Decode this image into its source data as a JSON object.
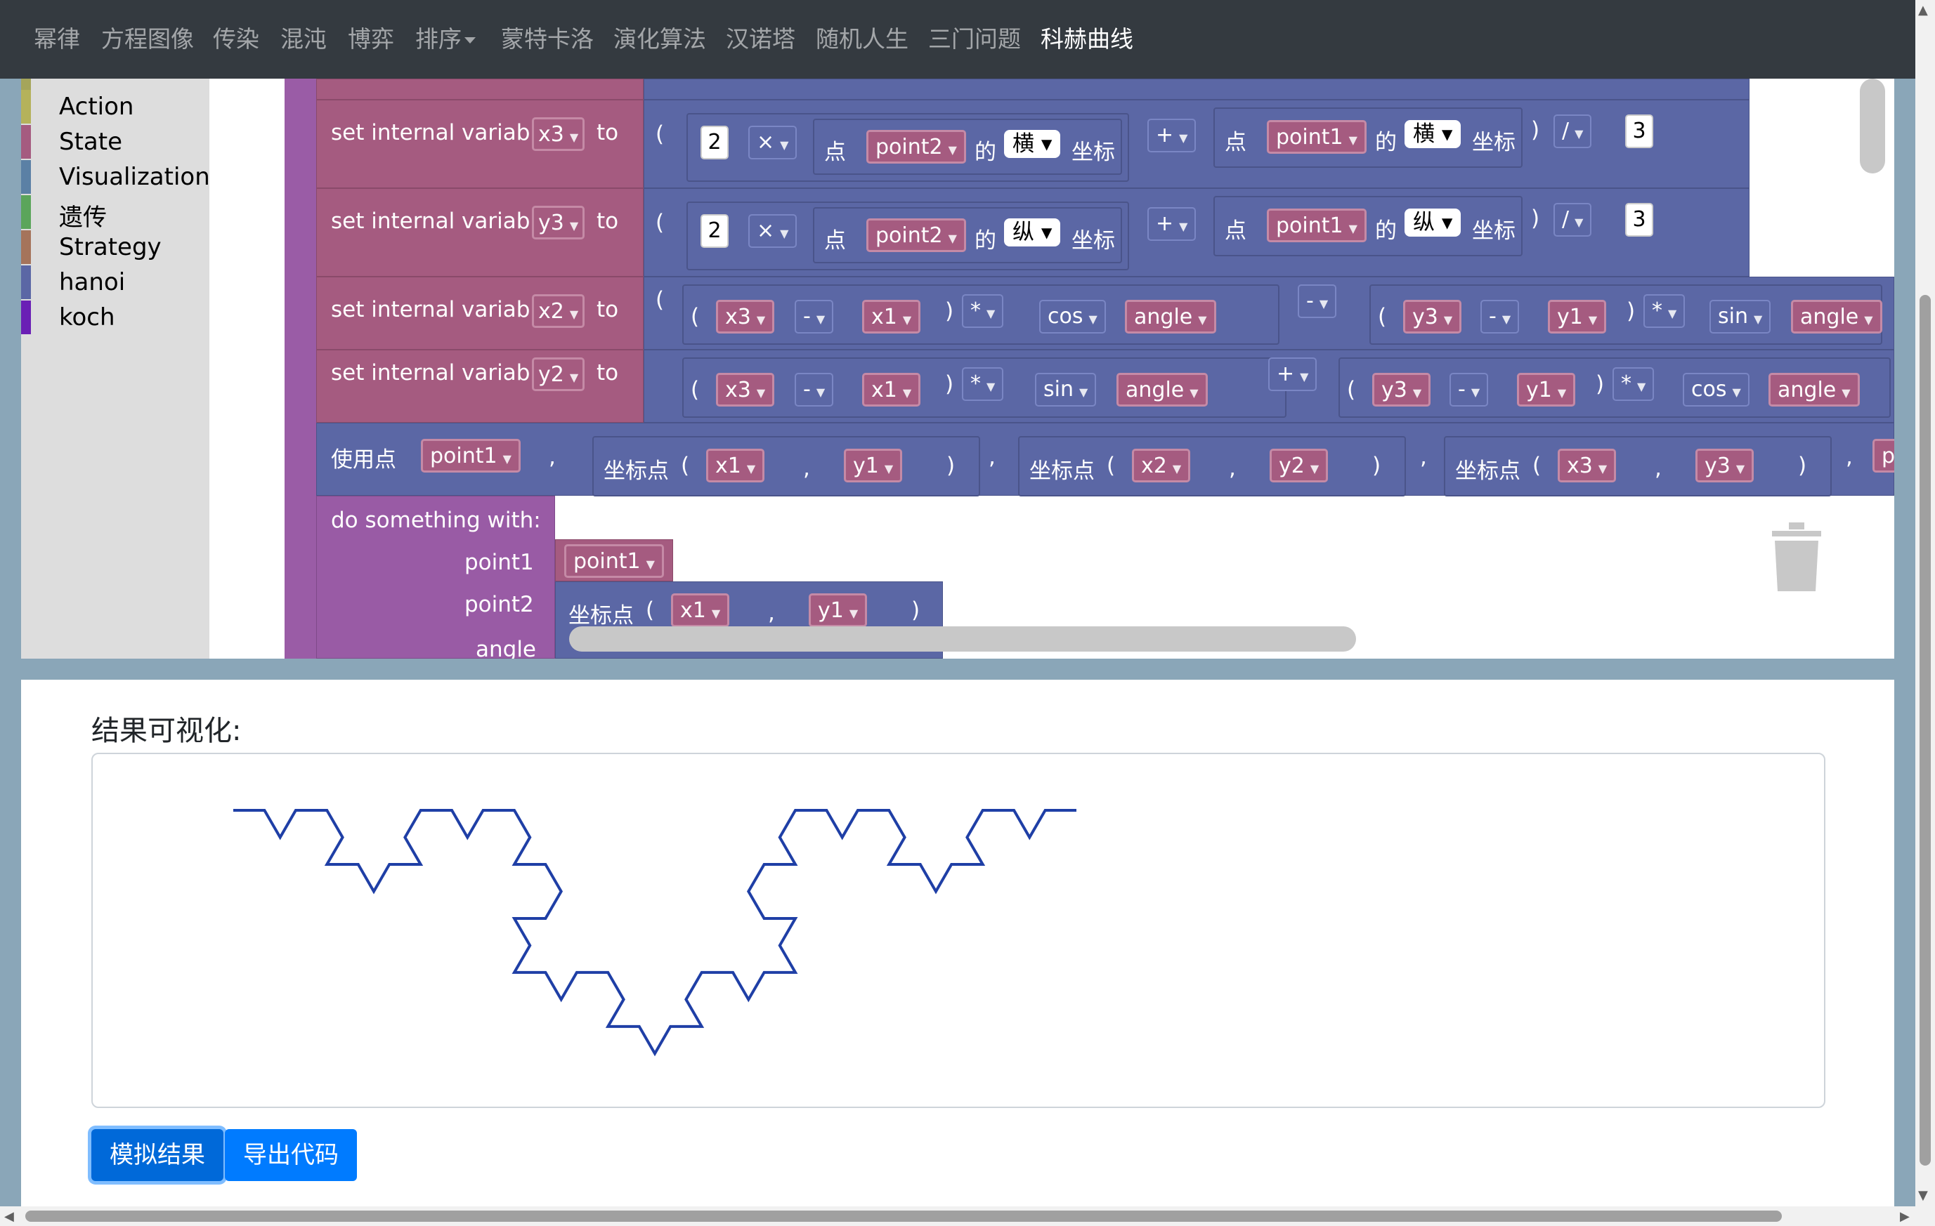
{
  "nav": {
    "items": [
      "幂律",
      "方程图像",
      "传染",
      "混沌",
      "博弈",
      "排序",
      "蒙特卡洛",
      "演化算法",
      "汉诺塔",
      "随机人生",
      "三门问题",
      "科赫曲线"
    ],
    "active": "科赫曲线"
  },
  "toolbox": {
    "categories": [
      {
        "label": "Action",
        "color": "#b5b25b"
      },
      {
        "label": "State",
        "color": "#a55b80"
      },
      {
        "label": "Visualization",
        "color": "#5b80a5"
      },
      {
        "label": "遗传",
        "color": "#5ba55b"
      },
      {
        "label": "Strategy",
        "color": "#a5745b"
      },
      {
        "label": "hanoi",
        "color": "#5b67a5"
      },
      {
        "label": "koch",
        "color": "#6a1fb5"
      }
    ]
  },
  "blocks": {
    "set_label": "set internal variable",
    "to_label": "to",
    "vars": {
      "x3": "x3",
      "y3": "y3",
      "x2": "x2",
      "y2": "y2",
      "x1": "x1",
      "y1": "y1",
      "angle": "angle",
      "point1": "point1",
      "point2": "point2"
    },
    "ops": {
      "times": "×",
      "plus": "+",
      "minus": "-",
      "mult": "*",
      "div": "/"
    },
    "funcs": {
      "cos": "cos",
      "sin": "sin"
    },
    "nums": {
      "two": "2",
      "three": "3"
    },
    "text": {
      "dian": "点",
      "de": "的",
      "heng": "横",
      "zong": "纵",
      "zuobiao": "坐标",
      "zuobiaodian": "坐标点",
      "lparen": "(",
      "rparen": ")",
      "comma": ",",
      "use_point": "使用点",
      "do_something": "do something  with:",
      "point1_label": "point1",
      "point2_label": "point2",
      "angle_label": "angle",
      "truncated_p": "p"
    }
  },
  "visualization": {
    "title": "结果可视化:",
    "line_color": "#1f3fa6"
  },
  "buttons": {
    "simulate": "模拟结果",
    "export": "导出代码"
  },
  "colors": {
    "nav_bg": "#343a40",
    "button": "#007bff",
    "set_block": "#a55b80",
    "expr_block": "#5b67a5",
    "proc_block": "#995ba5"
  }
}
